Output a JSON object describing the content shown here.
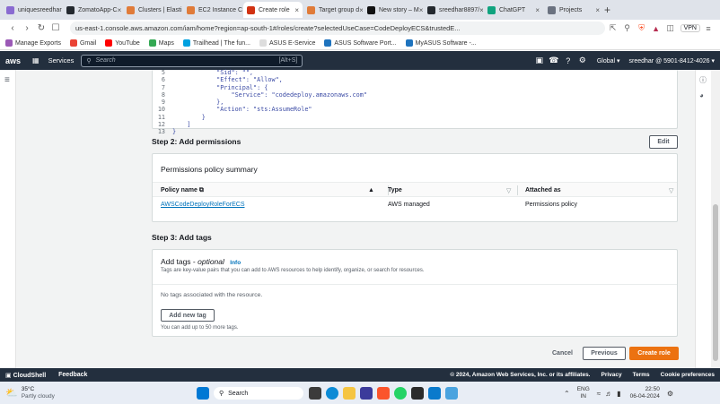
{
  "browser": {
    "tabs": [
      {
        "label": "uniquesreedhar",
        "color": "#8a6bd1",
        "active": false
      },
      {
        "label": "ZomatoApp-C",
        "color": "#24292f",
        "active": false
      },
      {
        "label": "Clusters | Elasti",
        "color": "#e07b39",
        "active": false
      },
      {
        "label": "EC2 Instance C",
        "color": "#e07b39",
        "active": false
      },
      {
        "label": "Create role",
        "color": "#d13212",
        "active": true
      },
      {
        "label": "Target group d",
        "color": "#e07b39",
        "active": false
      },
      {
        "label": "New story – M",
        "color": "#111111",
        "active": false
      },
      {
        "label": "sreedhar8897/",
        "color": "#24292f",
        "active": false
      },
      {
        "label": "ChatGPT",
        "color": "#10a37f",
        "active": false
      },
      {
        "label": "Projects",
        "color": "#6b7280",
        "active": false
      }
    ],
    "url": "us-east-1.console.aws.amazon.com/iam/home?region=ap-south-1#/roles/create?selectedUseCase=CodeDeployECS&trustedE...",
    "vpn": "VPN",
    "bookmarks": [
      {
        "label": "Manage Exports",
        "color": "#9b59b6"
      },
      {
        "label": "Gmail",
        "color": "#ea4335"
      },
      {
        "label": "YouTube",
        "color": "#ff0000"
      },
      {
        "label": "Maps",
        "color": "#34a853"
      },
      {
        "label": "Trailhead | The fun...",
        "color": "#00a1e0"
      },
      {
        "label": "ASUS E-Service",
        "color": "#dddddd"
      },
      {
        "label": "ASUS Software Port...",
        "color": "#1e73be"
      },
      {
        "label": "MyASUS Software -...",
        "color": "#1e73be"
      }
    ]
  },
  "aws": {
    "logo": "aws",
    "services": "Services",
    "search_placeholder": "Search",
    "search_shortcut": "[Alt+S]",
    "region": "Global",
    "account": "sreedhar @ 5901-8412-4026"
  },
  "code": {
    "lines": [
      {
        "n": "5",
        "text": "            \"Sid\": \"\","
      },
      {
        "n": "6",
        "text": "            \"Effect\": \"Allow\","
      },
      {
        "n": "7",
        "text": "            \"Principal\": {"
      },
      {
        "n": "8",
        "text": "                \"Service\": \"codedeploy.amazonaws.com\""
      },
      {
        "n": "9",
        "text": "            },"
      },
      {
        "n": "10",
        "text": "            \"Action\": \"sts:AssumeRole\""
      },
      {
        "n": "11",
        "text": "        }"
      },
      {
        "n": "12",
        "text": "    ]"
      },
      {
        "n": "13",
        "text": "}"
      }
    ]
  },
  "step2": {
    "title": "Step 2: Add permissions",
    "edit": "Edit",
    "summary_title": "Permissions policy summary",
    "columns": {
      "policy": "Policy name",
      "type": "Type",
      "attached": "Attached as"
    },
    "row": {
      "policy": "AWSCodeDeployRoleForECS",
      "type": "AWS managed",
      "attached": "Permissions policy"
    }
  },
  "step3": {
    "title": "Step 3: Add tags",
    "card_title": "Add tags - ",
    "optional": "optional",
    "info": "Info",
    "description": "Tags are key-value pairs that you can add to AWS resources to help identify, organize, or search for resources.",
    "empty": "No tags associated with the resource.",
    "add_button": "Add new tag",
    "limit": "You can add up to 50 more tags."
  },
  "actions": {
    "cancel": "Cancel",
    "previous": "Previous",
    "create": "Create role"
  },
  "footer": {
    "cloudshell": "CloudShell",
    "feedback": "Feedback",
    "copyright": "© 2024, Amazon Web Services, Inc. or its affiliates.",
    "privacy": "Privacy",
    "terms": "Terms",
    "cookies": "Cookie preferences"
  },
  "taskbar": {
    "temp": "35°C",
    "weather": "Partly cloudy",
    "search": "Search",
    "lang1": "ENG",
    "lang2": "IN",
    "time": "22:50",
    "date": "06-04-2024"
  }
}
